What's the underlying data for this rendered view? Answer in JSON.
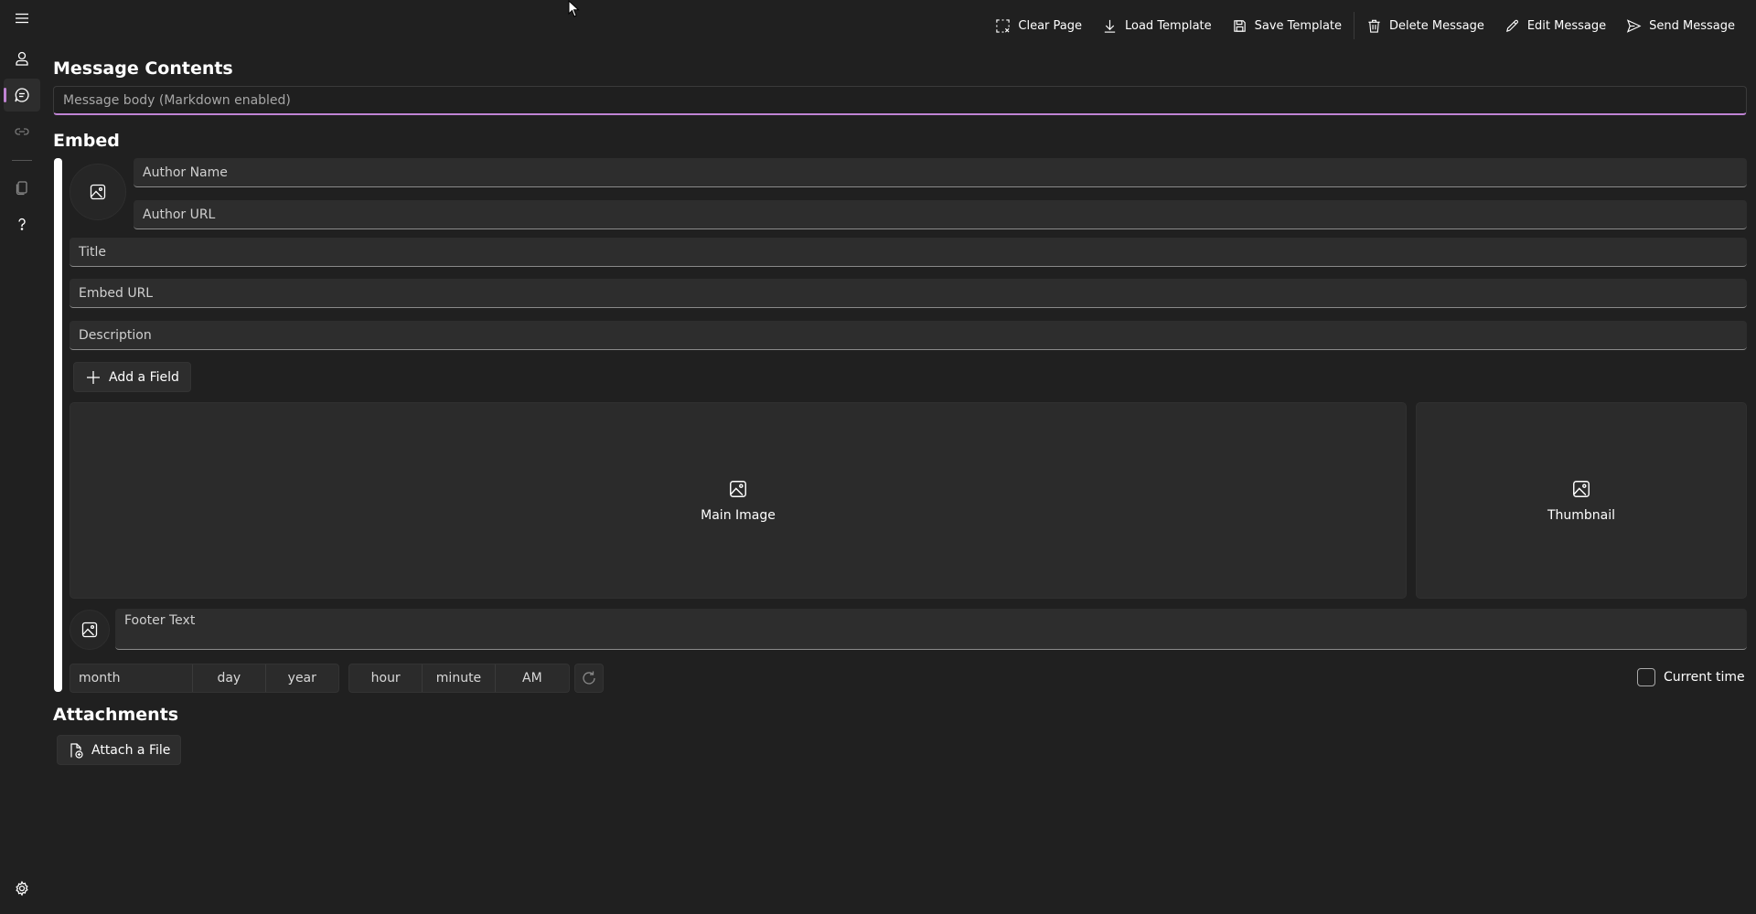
{
  "toolbar": {
    "clear_page": "Clear Page",
    "load_template": "Load Template",
    "save_template": "Save Template",
    "delete_message": "Delete Message",
    "edit_message": "Edit Message",
    "send_message": "Send Message"
  },
  "message": {
    "heading": "Message Contents",
    "body_placeholder": "Message body (Markdown enabled)"
  },
  "embed": {
    "heading": "Embed",
    "author_name_placeholder": "Author Name",
    "author_url_placeholder": "Author URL",
    "title_placeholder": "Title",
    "embed_url_placeholder": "Embed URL",
    "description_placeholder": "Description",
    "add_field_label": "Add a Field",
    "main_image_label": "Main Image",
    "thumbnail_label": "Thumbnail",
    "footer_placeholder": "Footer Text",
    "date": {
      "month": "month",
      "day": "day",
      "year": "year"
    },
    "time": {
      "hour": "hour",
      "minute": "minute",
      "ampm": "AM"
    },
    "current_time_label": "Current time",
    "accent_color": "#ffffff"
  },
  "attachments": {
    "heading": "Attachments",
    "attach_label": "Attach a File"
  },
  "theme": {
    "accent": "#c084d4",
    "background": "#202020"
  }
}
